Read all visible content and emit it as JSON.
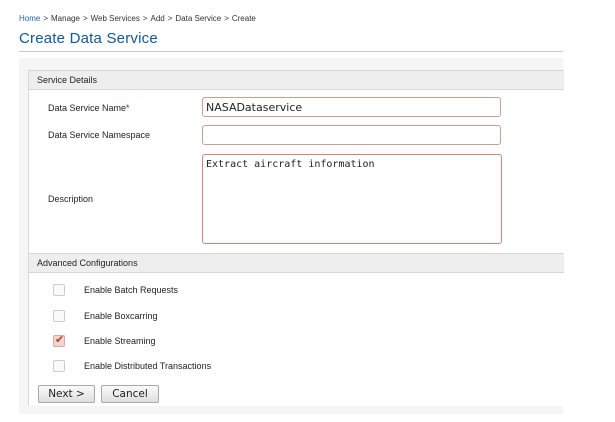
{
  "breadcrumb": {
    "items": [
      "Home",
      "Manage",
      "Web Services",
      "Add",
      "Data Service",
      "Create"
    ],
    "separator": ">"
  },
  "page": {
    "title": "Create Data Service"
  },
  "service_details": {
    "header": "Service Details",
    "name_label": "Data Service Name",
    "required_marker": "*",
    "name_value": "NASADataservice",
    "namespace_label": "Data Service Namespace",
    "namespace_value": "",
    "description_label": "Description",
    "description_value": "Extract aircraft information"
  },
  "advanced": {
    "header": "Advanced Configurations",
    "options": [
      {
        "label": "Enable Batch Requests",
        "checked": false
      },
      {
        "label": "Enable Boxcarring",
        "checked": false
      },
      {
        "label": "Enable Streaming",
        "checked": true
      },
      {
        "label": "Enable Distributed Transactions",
        "checked": false
      }
    ]
  },
  "buttons": {
    "next": "Next >",
    "cancel": "Cancel"
  },
  "colors": {
    "title": "#0b5aa8",
    "link": "#2266aa",
    "required": "#d00000",
    "check": "#c0392b"
  }
}
